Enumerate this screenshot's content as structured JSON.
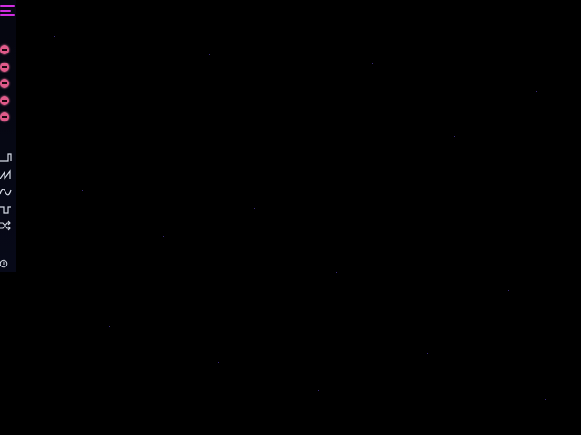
{
  "app": {
    "background_color": "#000000",
    "accent_color": "#d02de0",
    "remove_color": "#e05a8a",
    "icon_color": "#d6dbe6"
  },
  "sidebar": {
    "menu_icon": "hamburger-menu-icon",
    "remove_buttons": [
      {
        "icon": "remove-circle-icon"
      },
      {
        "icon": "remove-circle-icon"
      },
      {
        "icon": "remove-circle-icon"
      },
      {
        "icon": "remove-circle-icon"
      },
      {
        "icon": "remove-circle-icon"
      }
    ],
    "waveforms": [
      {
        "icon": "sawtooth-wave-icon"
      },
      {
        "icon": "triangle-wave-icon"
      },
      {
        "icon": "sine-wave-icon"
      },
      {
        "icon": "square-wave-icon"
      },
      {
        "icon": "shuffle-random-icon"
      }
    ],
    "power_icon": "power-icon"
  }
}
